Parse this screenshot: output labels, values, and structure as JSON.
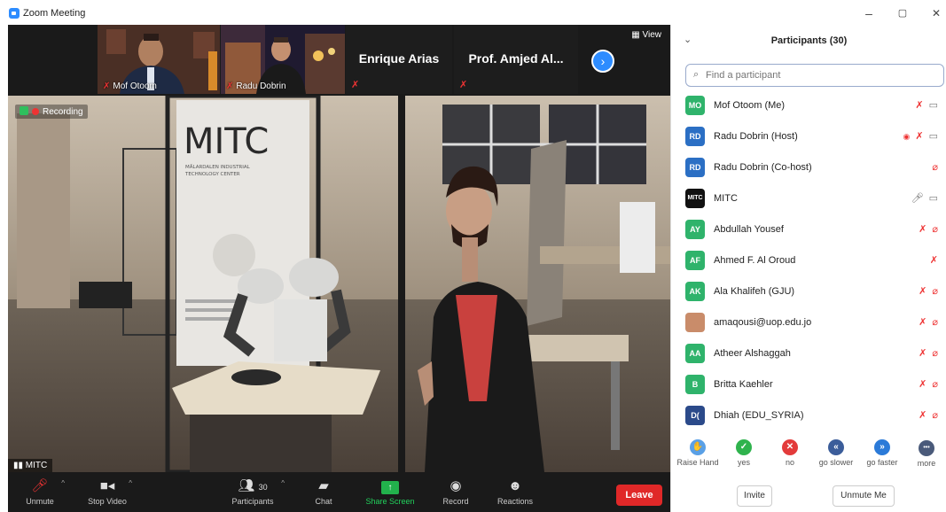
{
  "window": {
    "title": "Zoom Meeting",
    "controls": [
      "–",
      "▢",
      "✕"
    ]
  },
  "thumbnails": [
    {
      "name": "Mof Otoom",
      "muted": true
    },
    {
      "name": "Radu Dobrin",
      "muted": true
    }
  ],
  "name_tiles": [
    {
      "name": "Enrique Arias",
      "muted": true
    },
    {
      "name": "Prof. Amjed Al...",
      "muted": true
    }
  ],
  "view_label": "View",
  "main_video": {
    "recording_label": "Recording",
    "speaker_label": "MITC",
    "sign_title": "MITC",
    "sign_subtitle": "MÄLARDALEN INDUSTRIAL TECHNOLOGY CENTER"
  },
  "toolbar": {
    "unmute": "Unmute",
    "stop_video": "Stop Video",
    "participants": "Participants",
    "participants_count": "30",
    "chat": "Chat",
    "share_screen": "Share Screen",
    "record": "Record",
    "reactions": "Reactions",
    "leave": "Leave"
  },
  "panel": {
    "title": "Participants (30)",
    "search_placeholder": "Find a participant",
    "participants": [
      {
        "initials": "MO",
        "name": "Mof Otoom (Me)",
        "color": "#2fb36b",
        "icons": [
          "mic-off",
          "video"
        ]
      },
      {
        "initials": "RD",
        "name": "Radu Dobrin (Host)",
        "color": "#2b6fc4",
        "icons": [
          "recording",
          "mic-off",
          "video"
        ]
      },
      {
        "initials": "RD",
        "name": "Radu Dobrin (Co-host)",
        "color": "#2b6fc4",
        "icons": [
          "video-off"
        ]
      },
      {
        "initials": "MITC",
        "name": "MITC",
        "color": "#111111",
        "icons": [
          "mic-on",
          "video"
        ]
      },
      {
        "initials": "AY",
        "name": "Abdullah Yousef",
        "color": "#2fb36b",
        "icons": [
          "mic-off",
          "video-off"
        ]
      },
      {
        "initials": "AF",
        "name": "Ahmed F. Al Oroud",
        "color": "#2fb36b",
        "icons": [
          "mic-off"
        ]
      },
      {
        "initials": "AK",
        "name": "Ala Khalifeh (GJU)",
        "color": "#2fb36b",
        "icons": [
          "mic-off",
          "video-off"
        ]
      },
      {
        "initials": "",
        "name": "amaqousi@uop.edu.jo",
        "color": "#c98c6a",
        "icons": [
          "mic-off",
          "video-off"
        ]
      },
      {
        "initials": "AA",
        "name": "Atheer Alshaggah",
        "color": "#2fb36b",
        "icons": [
          "mic-off",
          "video-off"
        ]
      },
      {
        "initials": "B",
        "name": "Britta Kaehler",
        "color": "#2fb36b",
        "icons": [
          "mic-off",
          "video-off"
        ]
      },
      {
        "initials": "D(",
        "name": "Dhiah (EDU_SYRIA)",
        "color": "#2b4a8a",
        "icons": [
          "mic-off",
          "video-off"
        ]
      }
    ],
    "reactions": [
      {
        "label": "Raise Hand",
        "glyph": "✋",
        "color": "#5aa0e6"
      },
      {
        "label": "yes",
        "glyph": "✓",
        "color": "#2fb34d"
      },
      {
        "label": "no",
        "glyph": "✕",
        "color": "#e33b3b"
      },
      {
        "label": "go slower",
        "glyph": "«",
        "color": "#3b5d9a"
      },
      {
        "label": "go faster",
        "glyph": "»",
        "color": "#2b7ad8"
      },
      {
        "label": "more",
        "glyph": "•••",
        "color": "#4a5a7a"
      }
    ],
    "invite": "Invite",
    "unmute_me": "Unmute Me"
  }
}
